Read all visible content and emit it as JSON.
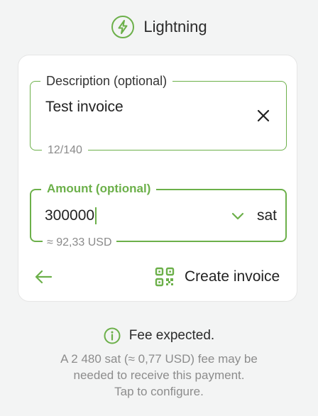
{
  "header": {
    "title": "Lightning",
    "icon": "lightning-icon"
  },
  "description_field": {
    "label": "Description (optional)",
    "value": "Test invoice",
    "counter": "12/140"
  },
  "amount_field": {
    "label": "Amount (optional)",
    "value": "300000",
    "unit": "sat",
    "conversion": "≈ 92,33 USD"
  },
  "actions": {
    "create_label": "Create invoice"
  },
  "fee": {
    "title": "Fee expected.",
    "line1": "A 2 480 sat (≈ 0,77 USD) fee may be",
    "line2": "needed to receive this payment.",
    "line3": "Tap to configure."
  },
  "colors": {
    "accent": "#6cb04a",
    "muted": "#8c8c8c",
    "background": "#f3f4f4"
  }
}
